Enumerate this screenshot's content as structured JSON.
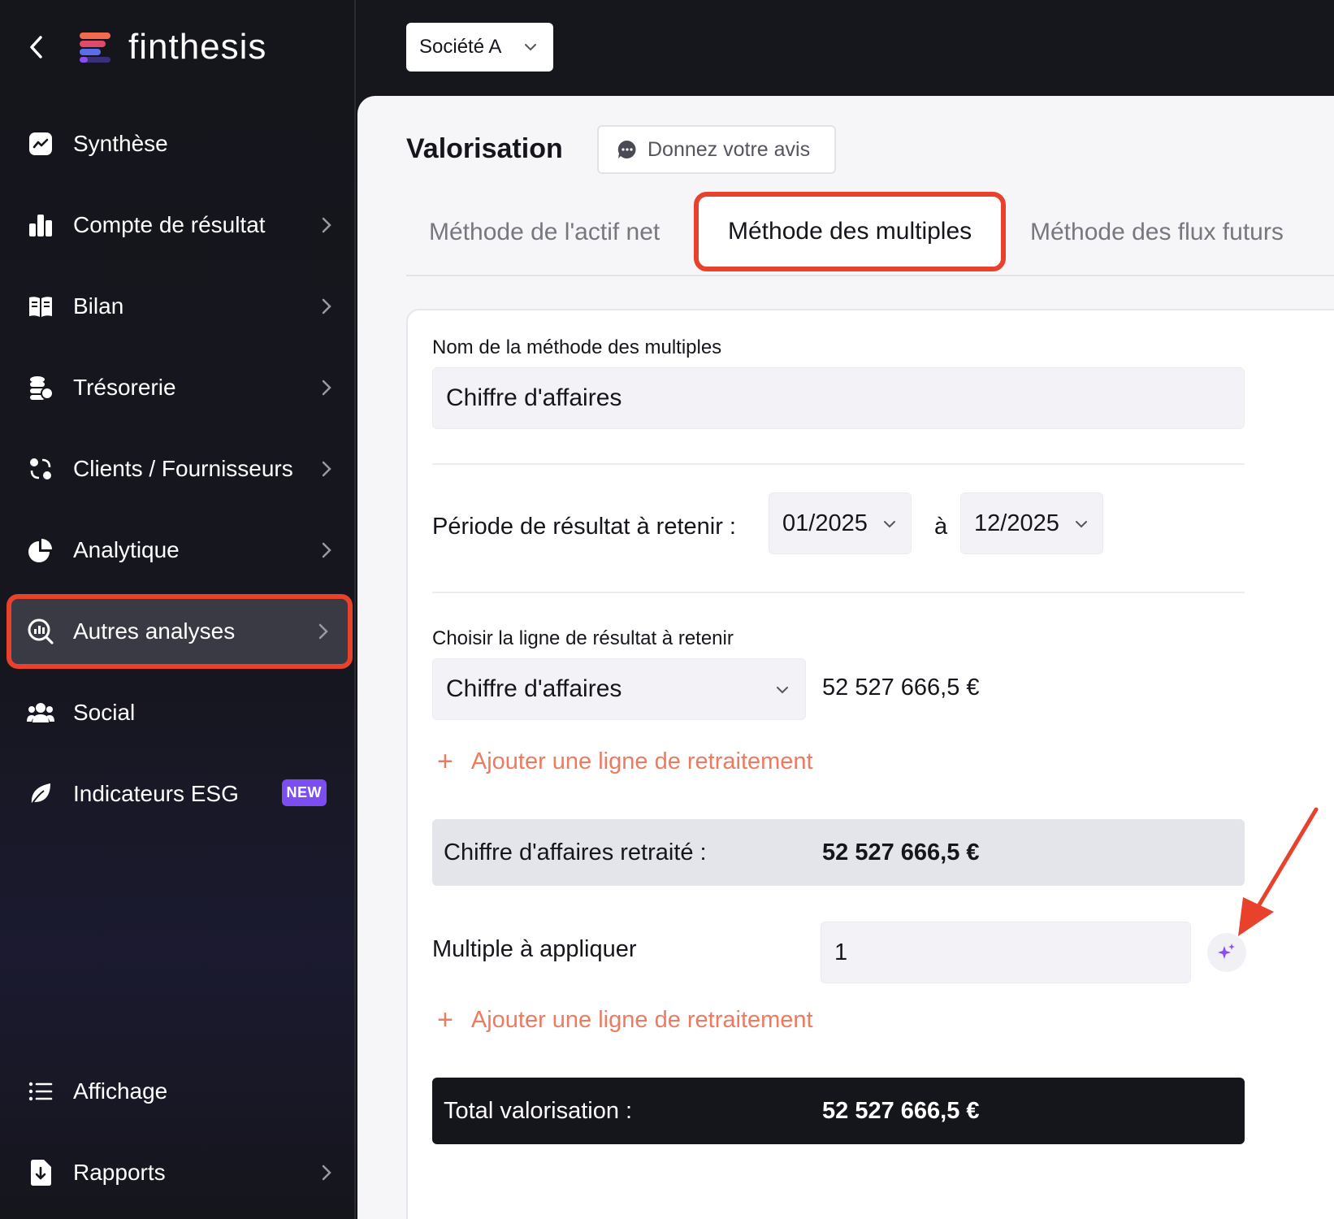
{
  "app": {
    "brand": "finthesis"
  },
  "sidebar": {
    "items": [
      {
        "label": "Synthèse",
        "icon": "chart-line-icon",
        "chevron": false
      },
      {
        "label": "Compte de résultat",
        "icon": "bar-chart-icon",
        "chevron": true
      },
      {
        "label": "Bilan",
        "icon": "book-icon",
        "chevron": true
      },
      {
        "label": "Trésorerie",
        "icon": "coins-icon",
        "chevron": true
      },
      {
        "label": "Clients / Fournisseurs",
        "icon": "exchange-icon",
        "chevron": true
      },
      {
        "label": "Analytique",
        "icon": "pie-chart-icon",
        "chevron": true
      },
      {
        "label": "Autres analyses",
        "icon": "magnifier-chart-icon",
        "chevron": true,
        "active": true
      },
      {
        "label": "Social",
        "icon": "users-icon",
        "chevron": false
      },
      {
        "label": "Indicateurs ESG",
        "icon": "leaf-icon",
        "chevron": false,
        "badge": "NEW"
      },
      {
        "label": "Affichage",
        "icon": "list-icon",
        "chevron": false
      },
      {
        "label": "Rapports",
        "icon": "file-download-icon",
        "chevron": true
      }
    ]
  },
  "header": {
    "company": "Société A"
  },
  "page": {
    "title": "Valorisation",
    "feedback_label": "Donnez votre avis",
    "tabs": [
      {
        "label": "Méthode de l'actif net",
        "active": false
      },
      {
        "label": "Méthode des multiples",
        "active": true
      },
      {
        "label": "Méthode des flux futurs",
        "active": false
      }
    ]
  },
  "form": {
    "name_label": "Nom de la méthode des multiples",
    "name_value": "Chiffre d'affaires",
    "period_label": "Période de résultat à retenir :",
    "period_start": "01/2025",
    "period_separator": "à",
    "period_end": "12/2025",
    "line_label": "Choisir la ligne de résultat à retenir",
    "line_value": "Chiffre d'affaires",
    "line_amount": "52 527 666,5 €",
    "add_line_label": "Ajouter une ligne de retraitement",
    "restated_label": "Chiffre d'affaires retraité :",
    "restated_value": "52 527 666,5 €",
    "multiple_label": "Multiple à appliquer",
    "multiple_value": "1",
    "total_label": "Total valorisation :",
    "total_value": "52 527 666,5 €"
  },
  "colors": {
    "accent_red": "#e8412c",
    "link_orange": "#ee7a60",
    "badge_purple": "#7c4df0",
    "sidebar_bg": "#15151c"
  }
}
